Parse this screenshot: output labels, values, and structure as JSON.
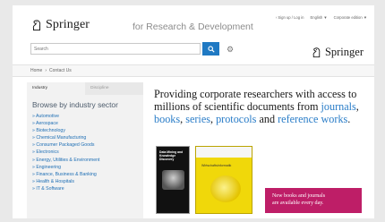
{
  "header": {
    "brand": "Springer",
    "tagline": "for Research & Development",
    "top_links": [
      "› Sign up / Log in",
      "English ▼",
      "Corporate edition ▼"
    ]
  },
  "search": {
    "placeholder": "Search",
    "button_icon": "search-icon",
    "settings_icon": "gear-icon"
  },
  "secondary_brand": "Springer",
  "breadcrumb": {
    "items": [
      "Home",
      "Contact Us"
    ],
    "separator": "›"
  },
  "left_panel": {
    "tabs": [
      {
        "label": "Industry",
        "active": true
      },
      {
        "label": "Discipline",
        "active": false
      }
    ],
    "title": "Browse by industry sector",
    "sectors": [
      "» Automotive",
      "» Aerospace",
      "» Biotechnology",
      "» Chemical Manufacturing",
      "» Consumer Packaged Goods",
      "» Electronics",
      "» Energy, Utilities & Environment",
      "» Engineering",
      "» Finance, Business & Banking",
      "» Health & Hospitals",
      "» IT & Software"
    ]
  },
  "main": {
    "headline_part1": "Providing corporate researchers with access to millions of scientific documents from ",
    "link_journals": "journals",
    "sep1": ", ",
    "link_books": "books",
    "sep2": ", ",
    "link_series": "series",
    "sep3": ", ",
    "link_protocols": "protocols",
    "sep4": " and ",
    "link_reference": "reference works",
    "end": ".",
    "book1_title": "Data Mining and Knowledge Discovery",
    "book2_title": "Wirtschaftsinformatik",
    "promo_line1": "New books and journals",
    "promo_line2": "are available every day."
  },
  "colors": {
    "accent_blue": "#1f79c3",
    "link_blue": "#2a7dc8",
    "promo_magenta": "#be1e67",
    "book_yellow": "#f0d80a"
  }
}
